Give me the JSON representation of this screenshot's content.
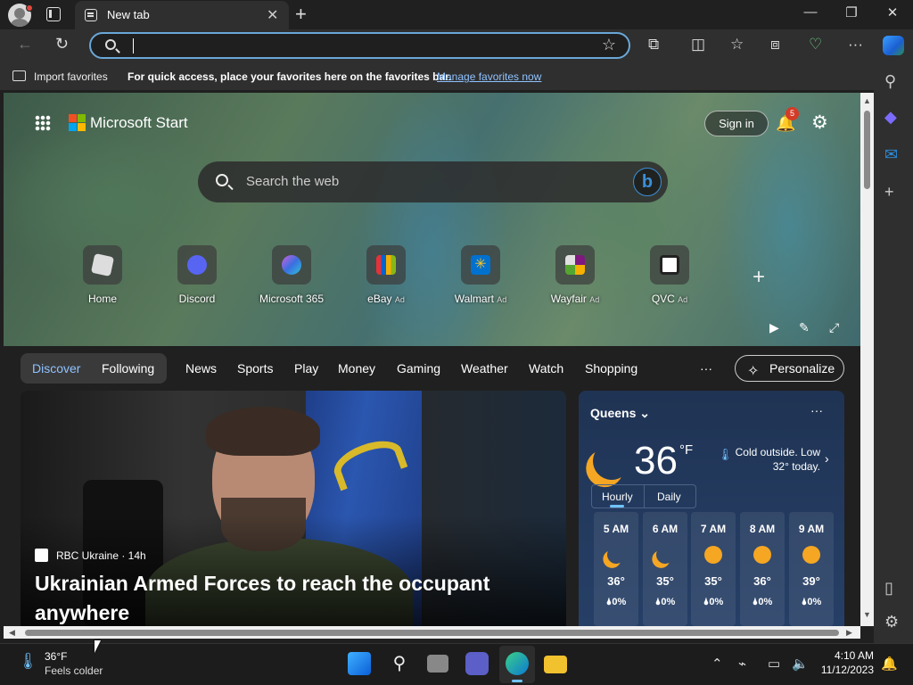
{
  "browser": {
    "tab_title": "New tab",
    "address_value": "",
    "favorites_bar": {
      "import_label": "Import favorites",
      "message": "For quick access, place your favorites here on the favorites bar.",
      "manage_link": "Manage favorites now"
    }
  },
  "start": {
    "brand": "Microsoft Start",
    "signin_label": "Sign in",
    "notification_count": "5",
    "search_placeholder": "Search the web",
    "tiles": [
      {
        "label": "Home",
        "ad": ""
      },
      {
        "label": "Discord",
        "ad": ""
      },
      {
        "label": "Microsoft 365",
        "ad": ""
      },
      {
        "label": "eBay",
        "ad": "Ad"
      },
      {
        "label": "Walmart",
        "ad": "Ad"
      },
      {
        "label": "Wayfair",
        "ad": "Ad"
      },
      {
        "label": "QVC",
        "ad": "Ad"
      }
    ],
    "nav": {
      "discover": "Discover",
      "following": "Following",
      "items": [
        "News",
        "Sports",
        "Play",
        "Money",
        "Gaming",
        "Weather",
        "Watch",
        "Shopping"
      ],
      "more": "···",
      "personalize": "Personalize"
    },
    "story": {
      "source": "RBC Ukraine · 14h",
      "headline": "Ukrainian Armed Forces to reach the occupant anywhere"
    },
    "weather": {
      "location": "Queens",
      "temp": "36",
      "unit": "°F",
      "note": "Cold outside. Low 32° today.",
      "tab_hourly": "Hourly",
      "tab_daily": "Daily",
      "hours": [
        {
          "time": "5 AM",
          "temp": "36°",
          "precip": "0%",
          "icon": "moon-icon"
        },
        {
          "time": "6 AM",
          "temp": "35°",
          "precip": "0%",
          "icon": "moon-icon"
        },
        {
          "time": "7 AM",
          "temp": "35°",
          "precip": "0%",
          "icon": "sun-icon"
        },
        {
          "time": "8 AM",
          "temp": "36°",
          "precip": "0%",
          "icon": "sun-icon"
        },
        {
          "time": "9 AM",
          "temp": "39°",
          "precip": "0%",
          "icon": "sun-icon"
        }
      ]
    }
  },
  "taskbar": {
    "weather_temp": "36°F",
    "weather_desc": "Feels colder",
    "time": "4:10 AM",
    "date": "11/12/2023"
  },
  "colors": {
    "accent": "#8fc2ff",
    "weather_bg": "#233a5e",
    "sun": "#f5a623"
  }
}
